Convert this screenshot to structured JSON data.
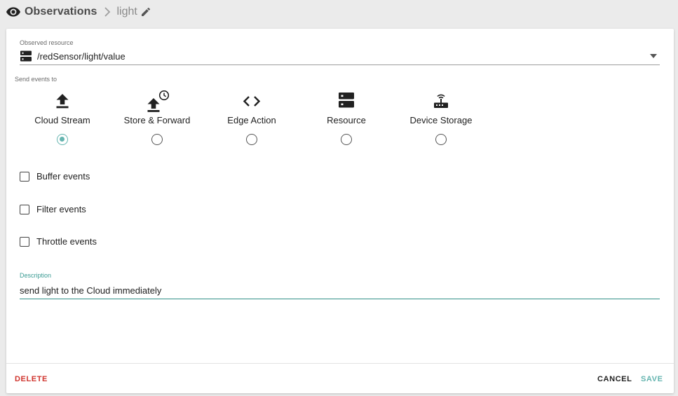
{
  "breadcrumb": {
    "root": "Observations",
    "leaf": "light"
  },
  "observed_resource": {
    "label": "Observed resource",
    "value": "/redSensor/light/value"
  },
  "send_events": {
    "label": "Send events to",
    "options": [
      {
        "label": "Cloud Stream",
        "icon": "upload-icon",
        "selected": true
      },
      {
        "label": "Store & Forward",
        "icon": "upload-clock-icon",
        "selected": false
      },
      {
        "label": "Edge Action",
        "icon": "code-icon",
        "selected": false
      },
      {
        "label": "Resource",
        "icon": "server-icon",
        "selected": false
      },
      {
        "label": "Device Storage",
        "icon": "router-icon",
        "selected": false
      }
    ]
  },
  "checkboxes": {
    "buffer": "Buffer events",
    "filter": "Filter events",
    "throttle": "Throttle events"
  },
  "description": {
    "label": "Description",
    "value": "send light to the Cloud immediately"
  },
  "footer": {
    "delete": "DELETE",
    "cancel": "CANCEL",
    "save": "SAVE"
  },
  "colors": {
    "accent": "#66b5b0",
    "description_accent": "#3a9b93",
    "danger": "#d0362f"
  }
}
